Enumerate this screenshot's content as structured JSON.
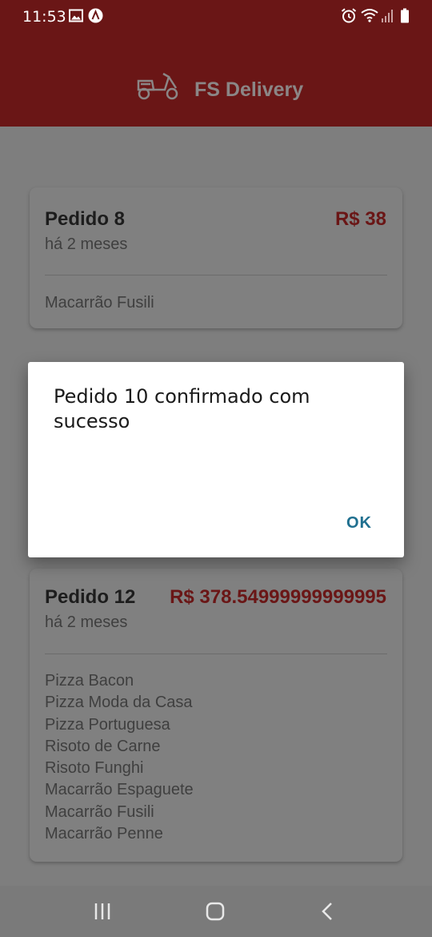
{
  "status_bar": {
    "time": "11:53",
    "icons": [
      "gallery-icon",
      "notification-a-icon",
      "alarm-icon",
      "wifi-icon",
      "signal-icon",
      "battery-icon"
    ]
  },
  "header": {
    "logo_icon": "scooter-icon",
    "title": "FS Delivery"
  },
  "orders": [
    {
      "title": "Pedido 8",
      "price": "R$ 38",
      "date": "há 2 meses",
      "items": [
        "Macarrão Fusili"
      ]
    },
    {
      "title": "Pedido 12",
      "price": "R$ 378.54999999999995",
      "date": "há 2 meses",
      "items": [
        "Pizza Bacon",
        "Pizza Moda da Casa",
        "Pizza Portuguesa",
        "Risoto de Carne",
        "Risoto Funghi",
        "Macarrão Espaguete",
        "Macarrão Fusili",
        "Macarrão Penne"
      ]
    }
  ],
  "dialog": {
    "message": "Pedido 10 confirmado com sucesso",
    "ok_label": "OK"
  },
  "nav_bar": {
    "icons": [
      "recent-apps-icon",
      "home-icon",
      "back-icon"
    ]
  },
  "colors": {
    "brand": "#6a1616",
    "dialog_accent": "#1f6f8f"
  }
}
